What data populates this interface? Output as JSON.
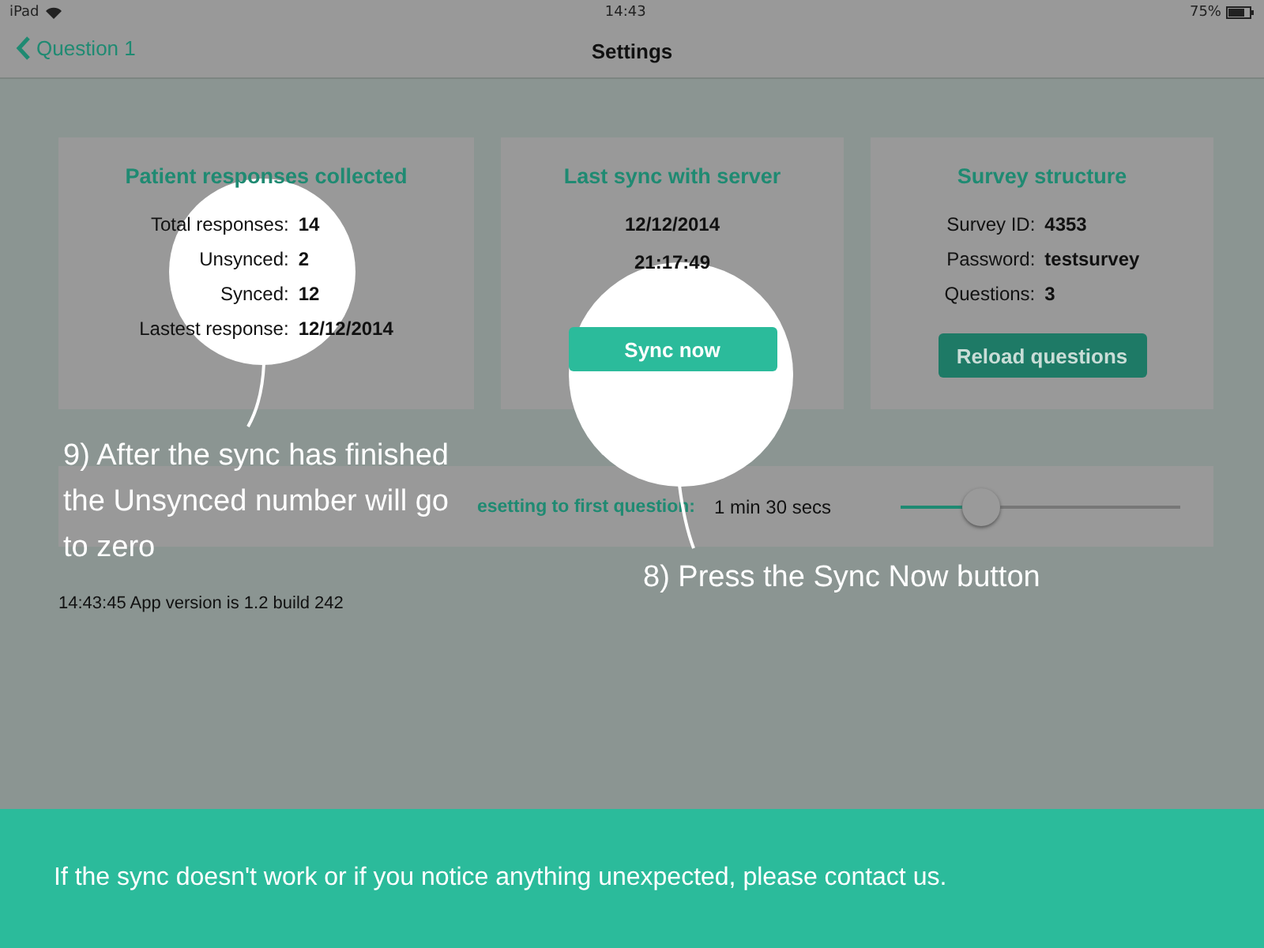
{
  "status_bar": {
    "device": "iPad",
    "time": "14:43",
    "battery": "75%"
  },
  "nav": {
    "back": "Question 1",
    "title": "Settings"
  },
  "responses_card": {
    "title": "Patient responses collected",
    "rows": [
      {
        "label": "Total responses:",
        "value": "14"
      },
      {
        "label": "Unsynced:",
        "value": "2"
      },
      {
        "label": "Synced:",
        "value": "12"
      },
      {
        "label": "Lastest response:",
        "value": "12/12/2014"
      }
    ]
  },
  "sync_card": {
    "title": "Last sync with server",
    "date": "12/12/2014",
    "time": "21:17:49",
    "button": "Sync now"
  },
  "survey_card": {
    "title": "Survey structure",
    "rows": [
      {
        "label": "Survey ID:",
        "value": "4353"
      },
      {
        "label": "Password:",
        "value": "testsurvey"
      },
      {
        "label": "Questions:",
        "value": "3"
      }
    ],
    "button": "Reload questions"
  },
  "timeout": {
    "label": "esetting to first question:",
    "value": "1 min 30 secs",
    "level": 0.29
  },
  "version": "14:43:45 App version is 1.2 build 242",
  "callouts": [
    {
      "text": "9) After the sync has finished the Unsynced number will go to zero"
    },
    {
      "text": "8) Press the Sync Now button"
    }
  ],
  "banner": "If the sync doesn't work or if you notice anything unexpected, please contact us."
}
